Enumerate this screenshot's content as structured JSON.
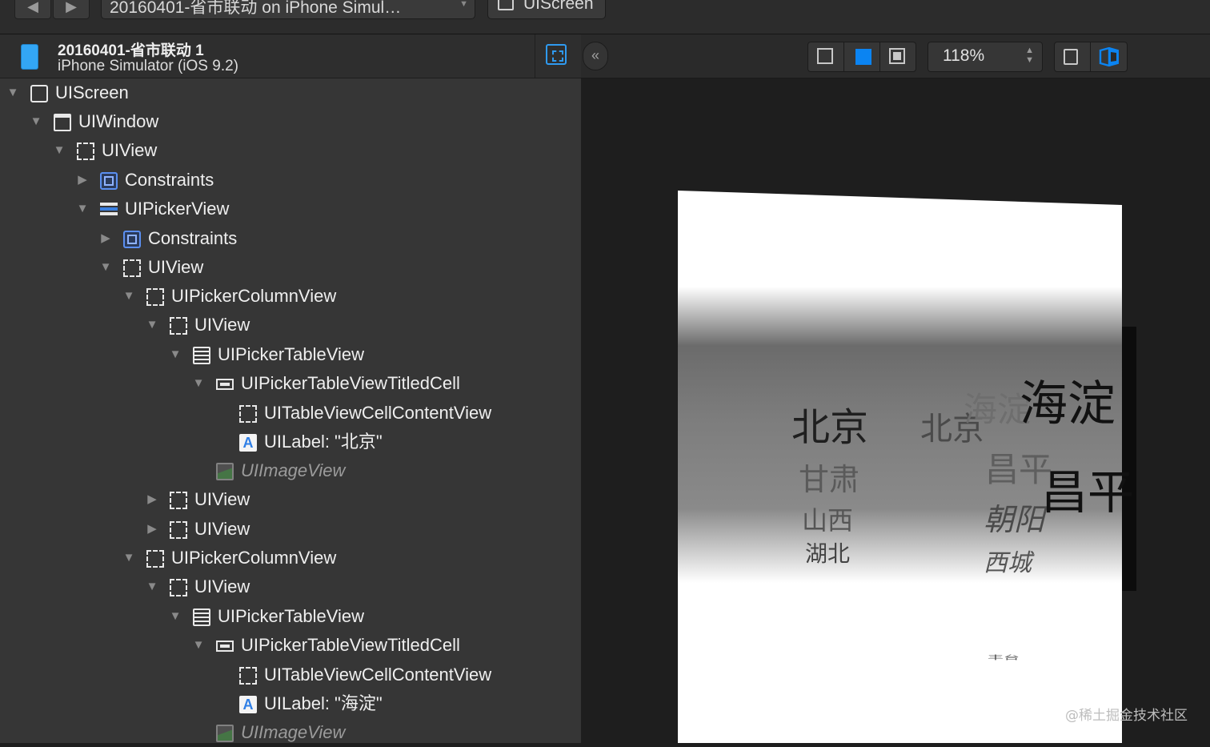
{
  "topbar": {
    "back_icon": "◀",
    "forward_icon": "▶",
    "jump_title": "20160401-省市联动 on iPhone Simul…",
    "screen_label": "UIScreen"
  },
  "device": {
    "name": "20160401-省市联动 1",
    "os": "iPhone Simulator (iOS 9.2)"
  },
  "tree": {
    "expanded_glyph": "▼",
    "collapsed_glyph": "▶",
    "rows": [
      {
        "label": "UIScreen"
      },
      {
        "label": "UIWindow"
      },
      {
        "label": "UIView"
      },
      {
        "label": "Constraints"
      },
      {
        "label": "UIPickerView"
      },
      {
        "label": "Constraints"
      },
      {
        "label": "UIView"
      },
      {
        "label": "UIPickerColumnView"
      },
      {
        "label": "UIView"
      },
      {
        "label": "UIPickerTableView"
      },
      {
        "label": "UIPickerTableViewTitledCell"
      },
      {
        "label": "UITableViewCellContentView"
      },
      {
        "label": "UILabel: \"北京\""
      },
      {
        "label": "UIImageView"
      },
      {
        "label": "UIView"
      },
      {
        "label": "UIView"
      },
      {
        "label": "UIPickerColumnView"
      },
      {
        "label": "UIView"
      },
      {
        "label": "UIPickerTableView"
      },
      {
        "label": "UIPickerTableViewTitledCell"
      },
      {
        "label": "UITableViewCellContentView"
      },
      {
        "label": "UILabel: \"海淀\""
      },
      {
        "label": "UIImageView"
      }
    ]
  },
  "canvas_toolbar": {
    "collapse_icon": "«",
    "zoom": "118%",
    "stepper_icon": "▲▼"
  },
  "picker_preview": {
    "col1": [
      "北京",
      "甘肃",
      "山西",
      "湖北"
    ],
    "col2_ghost": [
      "北京"
    ],
    "col3": [
      "海淀",
      "昌平",
      "朝阳",
      "西城",
      "丰台"
    ],
    "col3_front": [
      "海淀",
      "昌平"
    ]
  },
  "watermark": "@稀土掘金技术社区",
  "colors": {
    "accent": "#0b84f2",
    "panel_bg": "#363636",
    "canvas_bg": "#1e1e1e"
  }
}
